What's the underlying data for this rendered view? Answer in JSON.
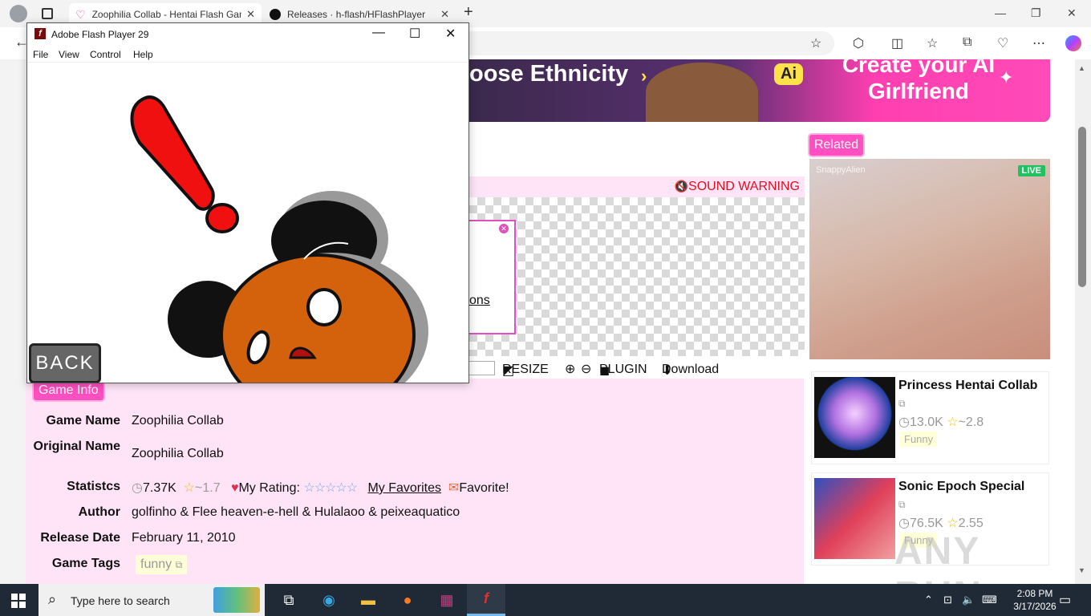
{
  "browser": {
    "tabs": [
      {
        "title": "Zoophilia Collab - Hentai Flash Games",
        "active": true
      },
      {
        "title": "Releases · h-flash/HFlashPlayer",
        "active": false
      }
    ],
    "new_tab": "+",
    "back_arrow": "←"
  },
  "flash_window": {
    "title": "Adobe Flash Player 29",
    "menu": [
      "File",
      "View",
      "Control",
      "Help"
    ],
    "back_button": "BACK"
  },
  "page": {
    "banner": {
      "left_text": "oose Ethnicity",
      "ai_badge": "Ai",
      "cta": "Create your AI Girlfriend"
    },
    "sound_warning": "SOUND WARNING",
    "ad_link_tail": "ons",
    "controls": {
      "resize": "RESIZE",
      "plugin": "PLUGIN",
      "download": "Download"
    },
    "game_info": {
      "heading": "Game Info",
      "rows": {
        "game_name_label": "Game Name",
        "game_name": "Zoophilia Collab",
        "original_name_label": "Original Name",
        "original_name": "Zoophilia Collab",
        "statistics_label": "Statistcs",
        "views": "7.37K",
        "rating": "~1.7",
        "my_rating_label": "My Rating:",
        "my_favorites": "My Favorites",
        "favorite": "Favorite!",
        "author_label": "Author",
        "author": "golfinho & Flee heaven-e-hell & Hulalaoo & peixeaquatico",
        "release_date_label": "Release Date",
        "release_date": "February 11, 2010",
        "game_tags_label": "Game Tags",
        "tag": "funny"
      }
    },
    "related": {
      "heading": "Related",
      "cam": {
        "live": "LIVE",
        "user": "SnappyAlien"
      },
      "items": [
        {
          "title": "Princess Hentai Collab",
          "views": "13.0K",
          "rating": "~2.8",
          "tag": "Funny"
        },
        {
          "title": "Sonic Epoch Special",
          "views": "76.5K",
          "rating": "2.55",
          "tag": "Funny"
        }
      ]
    },
    "watermark": "ANY RUN"
  },
  "taskbar": {
    "search_placeholder": "Type here to search",
    "time": "2:08 PM",
    "date": "3/17/2026"
  }
}
